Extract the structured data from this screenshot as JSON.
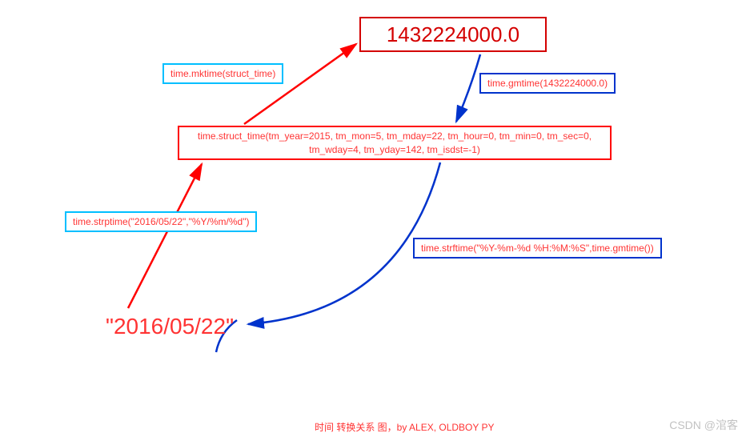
{
  "nodes": {
    "timestamp": "1432224000.0",
    "struct_time": "time.struct_time(tm_year=2015, tm_mon=5, tm_mday=22, tm_hour=0, tm_min=0, tm_sec=0, tm_wday=4, tm_yday=142, tm_isdst=-1)",
    "date_string": "\"2016/05/22\""
  },
  "labels": {
    "mktime": "time.mktime(struct_time)",
    "gmtime": "time.gmtime(1432224000.0)",
    "strptime": "time.strptime(\"2016/05/22\",\"%Y/%m/%d\")",
    "strftime": "time.strftime(\"%Y-%m-%d %H:%M:%S\",time.gmtime())"
  },
  "caption": "时间 转换关系 图，by ALEX, OLDBOY PY",
  "watermark": "CSDN @涫客"
}
